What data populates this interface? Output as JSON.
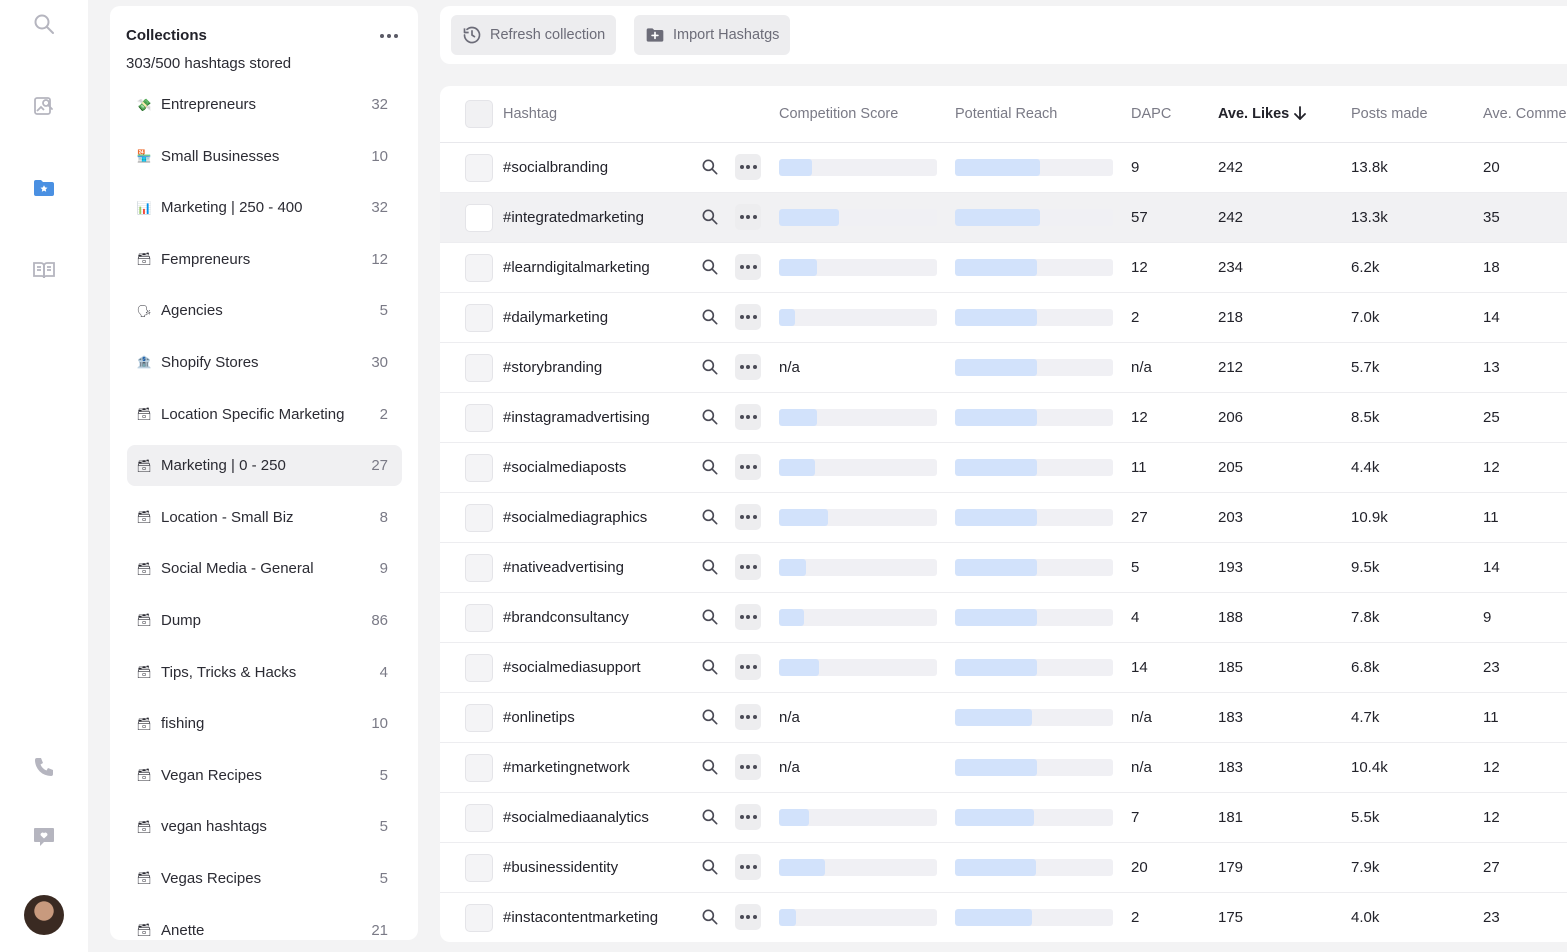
{
  "rail": {
    "icons": [
      "search-icon",
      "image-search-icon",
      "star-folder-icon",
      "book-icon",
      "phone-icon",
      "chat-heart-icon"
    ]
  },
  "collections": {
    "title": "Collections",
    "stored": "303/500 hashtags stored",
    "items": [
      {
        "emoji": "💸",
        "name": "Entrepreneurs",
        "count": "32"
      },
      {
        "emoji": "🏪",
        "name": "Small Businesses",
        "count": "10"
      },
      {
        "emoji": "📊",
        "name": "Marketing | 250 - 400",
        "count": "32"
      },
      {
        "emoji": "🗃",
        "name": "Fempreneurs",
        "count": "12"
      },
      {
        "emoji": "🗣",
        "name": "Agencies",
        "count": "5"
      },
      {
        "emoji": "🏦",
        "name": "Shopify Stores",
        "count": "30"
      },
      {
        "emoji": "🗃",
        "name": "Location Specific Marketing",
        "count": "2"
      },
      {
        "emoji": "🗃",
        "name": "Marketing | 0 - 250",
        "count": "27",
        "active": true
      },
      {
        "emoji": "🗃",
        "name": "Location - Small Biz",
        "count": "8"
      },
      {
        "emoji": "🗃",
        "name": "Social Media - General",
        "count": "9"
      },
      {
        "emoji": "🗃",
        "name": "Dump",
        "count": "86"
      },
      {
        "emoji": "🗃",
        "name": "Tips, Tricks & Hacks",
        "count": "4"
      },
      {
        "emoji": "🗃",
        "name": "fishing",
        "count": "10"
      },
      {
        "emoji": "🗃",
        "name": "Vegan Recipes",
        "count": "5"
      },
      {
        "emoji": "🗃",
        "name": "vegan hashtags",
        "count": "5"
      },
      {
        "emoji": "🗃",
        "name": "Vegas Recipes",
        "count": "5"
      },
      {
        "emoji": "🗃",
        "name": "Anette",
        "count": "21"
      }
    ]
  },
  "toolbar": {
    "refresh_label": "Refresh collection",
    "import_label": "Import Hashatgs"
  },
  "table": {
    "headers": {
      "hashtag": "Hashtag",
      "competition": "Competition Score",
      "reach": "Potential Reach",
      "dapc": "DAPC",
      "likes": "Ave. Likes",
      "posts": "Posts made",
      "comments": "Ave. Comme"
    },
    "rows": [
      {
        "tag": "#socialbranding",
        "competition": 0.21,
        "reach": 0.54,
        "dapc": "9",
        "likes": "242",
        "posts": "13.8k",
        "comments": "20"
      },
      {
        "tag": "#integratedmarketing",
        "competition": 0.38,
        "reach": 0.54,
        "dapc": "57",
        "likes": "242",
        "posts": "13.3k",
        "comments": "35",
        "highlight": true
      },
      {
        "tag": "#learndigitalmarketing",
        "competition": 0.24,
        "reach": 0.52,
        "dapc": "12",
        "likes": "234",
        "posts": "6.2k",
        "comments": "18"
      },
      {
        "tag": "#dailymarketing",
        "competition": 0.1,
        "reach": 0.52,
        "dapc": "2",
        "likes": "218",
        "posts": "7.0k",
        "comments": "14"
      },
      {
        "tag": "#storybranding",
        "competition": null,
        "competition_text": "n/a",
        "reach": 0.52,
        "dapc": "n/a",
        "likes": "212",
        "posts": "5.7k",
        "comments": "13"
      },
      {
        "tag": "#instagramadvertising",
        "competition": 0.24,
        "reach": 0.52,
        "dapc": "12",
        "likes": "206",
        "posts": "8.5k",
        "comments": "25"
      },
      {
        "tag": "#socialmediaposts",
        "competition": 0.23,
        "reach": 0.52,
        "dapc": "11",
        "likes": "205",
        "posts": "4.4k",
        "comments": "12"
      },
      {
        "tag": "#socialmediagraphics",
        "competition": 0.31,
        "reach": 0.52,
        "dapc": "27",
        "likes": "203",
        "posts": "10.9k",
        "comments": "11"
      },
      {
        "tag": "#nativeadvertising",
        "competition": 0.17,
        "reach": 0.52,
        "dapc": "5",
        "likes": "193",
        "posts": "9.5k",
        "comments": "14"
      },
      {
        "tag": "#brandconsultancy",
        "competition": 0.16,
        "reach": 0.52,
        "dapc": "4",
        "likes": "188",
        "posts": "7.8k",
        "comments": "9"
      },
      {
        "tag": "#socialmediasupport",
        "competition": 0.25,
        "reach": 0.52,
        "dapc": "14",
        "likes": "185",
        "posts": "6.8k",
        "comments": "23"
      },
      {
        "tag": "#onlinetips",
        "competition": null,
        "competition_text": "n/a",
        "reach": 0.49,
        "dapc": "n/a",
        "likes": "183",
        "posts": "4.7k",
        "comments": "11"
      },
      {
        "tag": "#marketingnetwork",
        "competition": null,
        "competition_text": "n/a",
        "reach": 0.52,
        "dapc": "n/a",
        "likes": "183",
        "posts": "10.4k",
        "comments": "12"
      },
      {
        "tag": "#socialmediaanalytics",
        "competition": 0.19,
        "reach": 0.5,
        "dapc": "7",
        "likes": "181",
        "posts": "5.5k",
        "comments": "12"
      },
      {
        "tag": "#businessidentity",
        "competition": 0.29,
        "reach": 0.51,
        "dapc": "20",
        "likes": "179",
        "posts": "7.9k",
        "comments": "27"
      },
      {
        "tag": "#instacontentmarketing",
        "competition": 0.11,
        "reach": 0.49,
        "dapc": "2",
        "likes": "175",
        "posts": "4.0k",
        "comments": "23"
      }
    ]
  },
  "colors": {
    "accent": "#4a90e2",
    "bar_fill": "#d2e2fb",
    "bar_track": "#f0f0f4"
  }
}
